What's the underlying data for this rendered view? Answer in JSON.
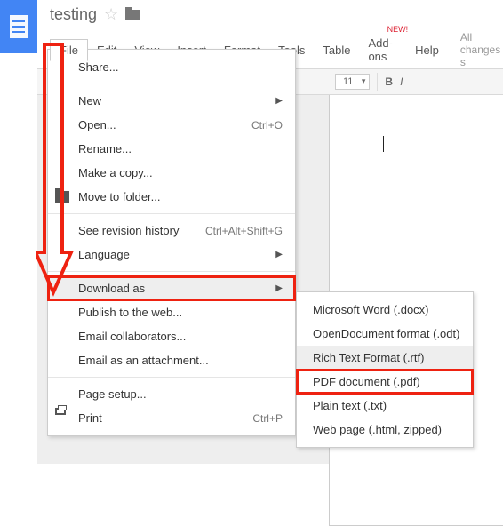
{
  "doc": {
    "title": "testing"
  },
  "menus": {
    "file": "File",
    "edit": "Edit",
    "view": "View",
    "insert": "Insert",
    "format": "Format",
    "tools": "Tools",
    "table": "Table",
    "addons": "Add-ons",
    "help": "Help",
    "new_badge": "NEW!"
  },
  "status": "All changes s",
  "toolbar": {
    "font_size": "11",
    "bold": "B",
    "italic": "I"
  },
  "file_menu": {
    "share": "Share...",
    "new": "New",
    "open": "Open...",
    "open_sc": "Ctrl+O",
    "rename": "Rename...",
    "make_copy": "Make a copy...",
    "move": "Move to folder...",
    "rev": "See revision history",
    "rev_sc": "Ctrl+Alt+Shift+G",
    "lang": "Language",
    "download": "Download as",
    "publish": "Publish to the web...",
    "email_collab": "Email collaborators...",
    "email_attach": "Email as an attachment...",
    "page_setup": "Page setup...",
    "print": "Print",
    "print_sc": "Ctrl+P"
  },
  "download_sub": {
    "docx": "Microsoft Word (.docx)",
    "odt": "OpenDocument format (.odt)",
    "rtf": "Rich Text Format (.rtf)",
    "pdf": "PDF document (.pdf)",
    "txt": "Plain text (.txt)",
    "html": "Web page (.html, zipped)"
  }
}
